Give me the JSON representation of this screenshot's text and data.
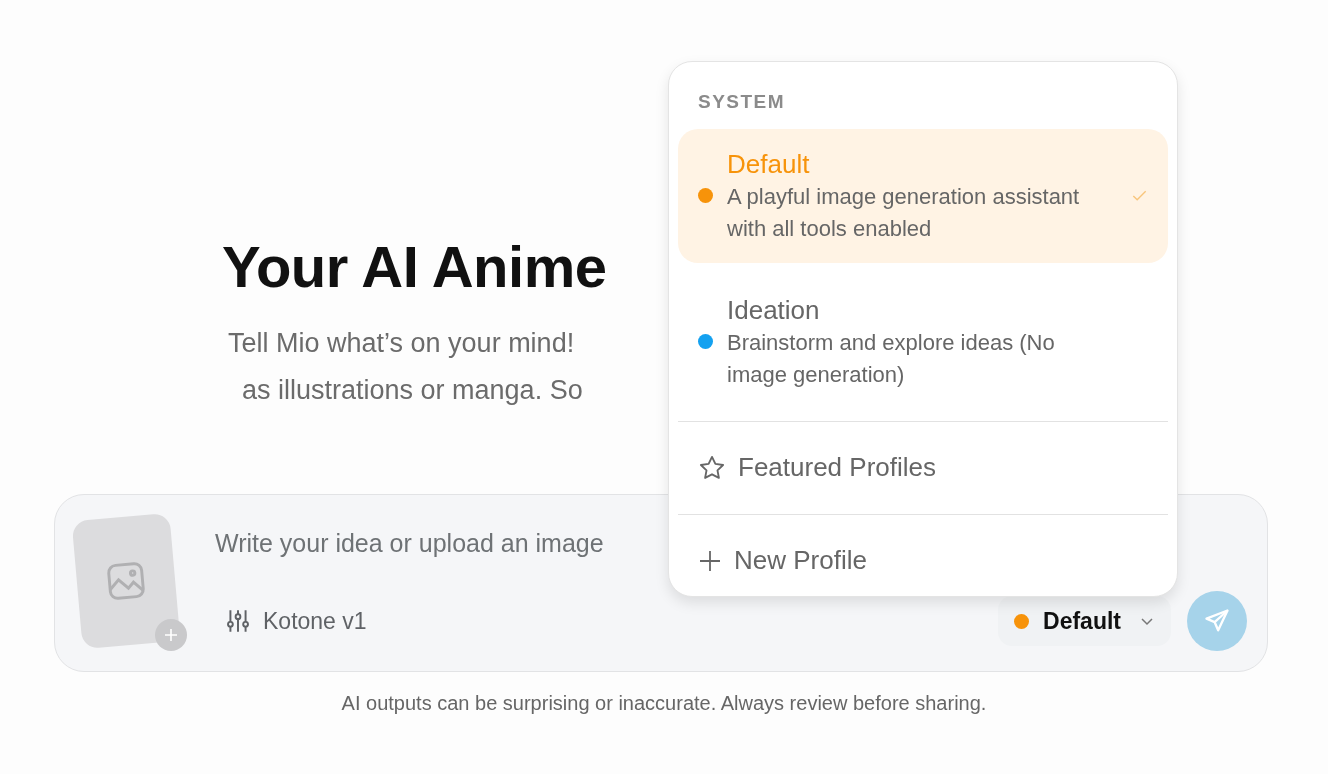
{
  "heading": "Your AI Anime",
  "subtitle_lines": [
    "Tell Mio what’s on your mind!",
    "as illustrations or manga. So"
  ],
  "composer": {
    "placeholder": "Write your idea or upload an image",
    "model": "Kotone v1",
    "profile": {
      "label": "Default",
      "color": "#f7930a"
    }
  },
  "disclaimer": "AI outputs can be surprising or inaccurate. Always review before sharing.",
  "menu": {
    "section": "SYSTEM",
    "profiles": [
      {
        "name": "Default",
        "description": "A playful image generation assistant with all tools enabled",
        "color": "#f7930a",
        "selected": true
      },
      {
        "name": "Ideation",
        "description": "Brainstorm and explore ideas (No image generation)",
        "color": "#14a1f0",
        "selected": false
      }
    ],
    "actions": [
      {
        "kind": "featured",
        "label": "Featured Profiles"
      },
      {
        "kind": "new",
        "label": "New Profile"
      }
    ]
  }
}
